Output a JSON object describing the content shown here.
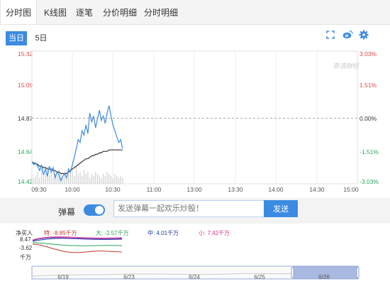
{
  "tabs": [
    {
      "label": "分时图",
      "active": true
    },
    {
      "label": "K线图",
      "active": false
    },
    {
      "label": "逐笔",
      "active": false
    },
    {
      "label": "分价明细",
      "active": false
    },
    {
      "label": "分时明细",
      "active": false
    }
  ],
  "periods": [
    {
      "label": "当日",
      "active": true
    },
    {
      "label": "5日",
      "active": false
    }
  ],
  "tools": {
    "fullscreen": "fullscreen-icon",
    "share": "weibo-icon",
    "settings": "gear-icon"
  },
  "chart_data": {
    "type": "line",
    "title": "",
    "y_left_ticks": [
      "15.32",
      "15.09",
      "14.87",
      "14.64",
      "14.42"
    ],
    "y_right_ticks": [
      "3.03%",
      "1.51%",
      "0.00%",
      "-1.51%",
      "-3.03%"
    ],
    "ylim": [
      14.42,
      15.32
    ],
    "prev_close": 14.87,
    "x_ticks": [
      "09:30",
      "10:00",
      "10:30",
      "11:00",
      "13:00",
      "13:30",
      "14:00",
      "14:30",
      "15:00"
    ],
    "watermark": "新浪财经",
    "colors": {
      "price": "#3c8be2",
      "avg": "#333333",
      "up": "#e24a4a",
      "down": "#2aa55b",
      "volume": "#d0d0d0"
    },
    "series": [
      {
        "values": [
          14.57,
          14.55,
          14.56,
          14.54,
          14.51,
          14.55,
          14.48,
          14.52,
          14.47,
          14.54,
          14.5,
          14.53,
          14.46,
          14.5,
          14.48,
          14.44,
          14.47,
          14.49,
          14.46,
          14.52,
          14.5,
          14.55,
          14.6,
          14.66,
          14.72,
          14.7,
          14.78,
          14.75,
          14.82,
          14.76,
          14.9,
          14.84,
          14.88,
          14.8,
          14.86,
          14.92,
          14.85,
          14.88,
          14.83,
          14.9,
          14.95,
          14.88,
          14.82,
          14.78,
          14.74,
          14.7,
          14.72,
          14.66
        ]
      },
      {
        "values": [
          14.57,
          14.56,
          14.56,
          14.55,
          14.54,
          14.54,
          14.53,
          14.53,
          14.52,
          14.52,
          14.52,
          14.51,
          14.51,
          14.5,
          14.5,
          14.49,
          14.49,
          14.49,
          14.49,
          14.5,
          14.51,
          14.52,
          14.53,
          14.54,
          14.55,
          14.56,
          14.57,
          14.58,
          14.59,
          14.59,
          14.6,
          14.61,
          14.61,
          14.62,
          14.62,
          14.63,
          14.63,
          14.64,
          14.64,
          14.64,
          14.65,
          14.65,
          14.65,
          14.65,
          14.65,
          14.65,
          14.65,
          14.65
        ]
      }
    ],
    "volume": [
      0.5,
      0.3,
      0.4,
      0.6,
      0.3,
      0.8,
      0.4,
      0.5,
      0.9,
      0.4,
      0.6,
      0.3,
      0.5,
      0.4,
      0.7,
      0.5,
      0.3,
      0.6,
      0.4,
      0.5,
      0.8,
      0.6,
      0.4,
      0.9,
      0.5,
      0.6,
      0.4,
      0.7,
      0.5,
      0.6,
      0.3,
      0.5,
      0.4,
      0.6,
      0.5,
      0.4,
      0.3,
      0.5,
      0.4,
      0.6,
      0.5,
      0.4,
      0.3,
      0.5,
      0.4,
      0.3,
      0.4,
      0.3
    ]
  },
  "danmu": {
    "label": "弹幕",
    "enabled": true,
    "placeholder": "发送弹幕一起欢乐炒股！",
    "send_label": "发送"
  },
  "flow": {
    "title": "净买入",
    "unit": "千万",
    "axis_top": "8.47",
    "axis_mid": "-3.62",
    "items": [
      {
        "label": "特: -8.85千万",
        "color": "#c0392b"
      },
      {
        "label": "大: -2.57千万",
        "color": "#2aa55b"
      },
      {
        "label": "中: 4.01千万",
        "color": "#1f3fa0"
      },
      {
        "label": "小: 7.42千万",
        "color": "#e0308a"
      }
    ]
  },
  "navigator": {
    "dates": [
      "6/19",
      "6/23",
      "6/24",
      "6/25",
      "6/26"
    ]
  }
}
